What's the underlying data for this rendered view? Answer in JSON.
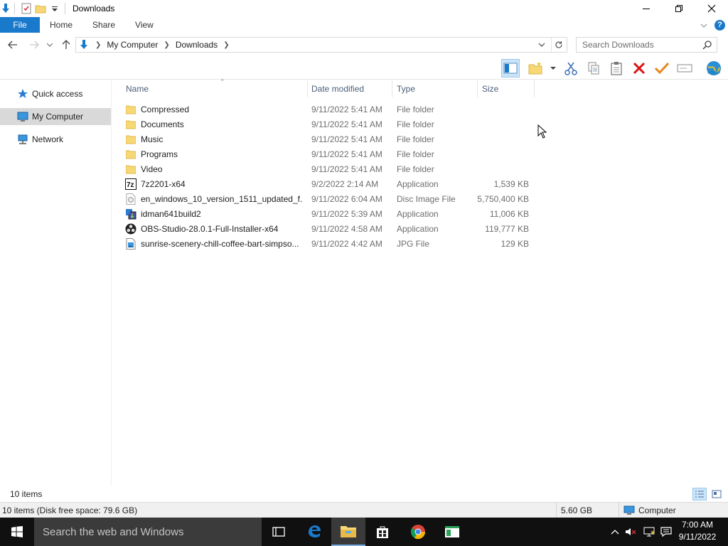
{
  "window": {
    "title": "Downloads",
    "icons": [
      "download-arrow-icon",
      "properties-icon",
      "new-folder-icon",
      "customize-dropdown-icon"
    ],
    "controls": [
      "minimize-icon",
      "restore-icon",
      "close-icon"
    ]
  },
  "ribbon": {
    "tabs": [
      {
        "label": "File"
      },
      {
        "label": "Home"
      },
      {
        "label": "Share"
      },
      {
        "label": "View"
      }
    ],
    "help_icon": "?"
  },
  "address": {
    "crumbs": [
      "My Computer",
      "Downloads"
    ],
    "search_placeholder": "Search Downloads"
  },
  "toolbar": {
    "buttons": [
      "preview-pane-icon",
      "new-folder-icon",
      "cut-icon",
      "copy-icon",
      "paste-icon",
      "delete-icon",
      "check-icon",
      "rename-icon",
      "globe-icon"
    ]
  },
  "nav": {
    "items": [
      {
        "label": "Quick access",
        "icon": "star-icon"
      },
      {
        "label": "My Computer",
        "icon": "computer-icon",
        "selected": true
      },
      {
        "label": "Network",
        "icon": "network-icon"
      }
    ]
  },
  "columns": {
    "name": "Name",
    "date": "Date modified",
    "type": "Type",
    "size": "Size"
  },
  "files": [
    {
      "name": "Compressed",
      "date": "9/11/2022 5:41 AM",
      "type": "File folder",
      "size": "",
      "icon": "folder-icon"
    },
    {
      "name": "Documents",
      "date": "9/11/2022 5:41 AM",
      "type": "File folder",
      "size": "",
      "icon": "folder-icon"
    },
    {
      "name": "Music",
      "date": "9/11/2022 5:41 AM",
      "type": "File folder",
      "size": "",
      "icon": "folder-icon"
    },
    {
      "name": "Programs",
      "date": "9/11/2022 5:41 AM",
      "type": "File folder",
      "size": "",
      "icon": "folder-icon"
    },
    {
      "name": "Video",
      "date": "9/11/2022 5:41 AM",
      "type": "File folder",
      "size": "",
      "icon": "folder-icon"
    },
    {
      "name": "7z2201-x64",
      "date": "9/2/2022 2:14 AM",
      "type": "Application",
      "size": "1,539 KB",
      "icon": "7zip-icon"
    },
    {
      "name": "en_windows_10_version_1511_updated_f...",
      "date": "9/11/2022 6:04 AM",
      "type": "Disc Image File",
      "size": "5,750,400 KB",
      "icon": "disc-image-icon"
    },
    {
      "name": "idman641build2",
      "date": "9/11/2022 5:39 AM",
      "type": "Application",
      "size": "11,006 KB",
      "icon": "idm-icon"
    },
    {
      "name": "OBS-Studio-28.0.1-Full-Installer-x64",
      "date": "9/11/2022 4:58 AM",
      "type": "Application",
      "size": "119,777 KB",
      "icon": "obs-icon"
    },
    {
      "name": "sunrise-scenery-chill-coffee-bart-simpso...",
      "date": "9/11/2022 4:42 AM",
      "type": "JPG File",
      "size": "129 KB",
      "icon": "image-file-icon"
    }
  ],
  "status": {
    "item_count": "10 items",
    "disk_info": "10 items (Disk free space: 79.6 GB)",
    "selected_size": "5.60 GB",
    "zone": "Computer"
  },
  "taskbar": {
    "search_placeholder": "Search the web and Windows",
    "time": "7:00 AM",
    "date": "9/11/2022"
  },
  "colors": {
    "accent": "#1979ca",
    "folder": "#f8d775",
    "selection": "#cce4f7",
    "taskbar": "#101010"
  }
}
